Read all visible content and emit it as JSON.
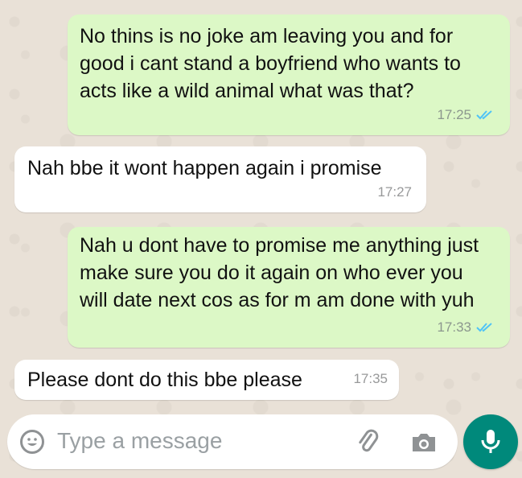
{
  "messages": [
    {
      "direction": "out",
      "text": "No thins is no joke am leaving you and for good i cant stand a boyfriend who wants to acts like a wild animal what was that?",
      "time": "17:25",
      "status": "read"
    },
    {
      "direction": "in",
      "text": "Nah bbe it wont happen again i promise",
      "time": "17:27"
    },
    {
      "direction": "out",
      "text": "Nah u dont have to promise me anything just make sure you do it again on who ever you will date next cos as for m am done with yuh",
      "time": "17:33",
      "status": "read"
    },
    {
      "direction": "in",
      "text": "Please dont do this bbe please",
      "time": "17:35"
    }
  ],
  "composer": {
    "placeholder": "Type a message",
    "icons": [
      "emoji-icon",
      "attach-icon",
      "camera-icon",
      "mic-icon"
    ]
  },
  "colors": {
    "outgoing_bubble": "#dcf8c6",
    "incoming_bubble": "#ffffff",
    "read_ticks": "#4fc3f7",
    "mic_button": "#00897b"
  }
}
